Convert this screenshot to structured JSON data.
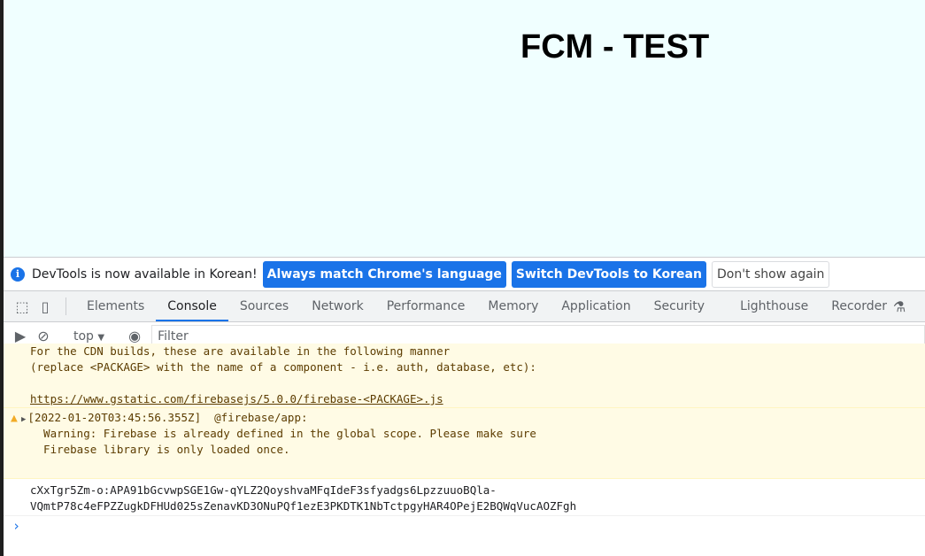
{
  "page": {
    "title": "FCM - TEST"
  },
  "infobar": {
    "message": "DevTools is now available in Korean!",
    "btn_match": "Always match Chrome's language",
    "btn_switch": "Switch DevTools to Korean",
    "btn_dismiss": "Don't show again"
  },
  "tabs": [
    "Elements",
    "Console",
    "Sources",
    "Network",
    "Performance",
    "Memory",
    "Application",
    "Security",
    "Lighthouse",
    "Recorder"
  ],
  "active_tab": "Console",
  "toolbar": {
    "context": "top",
    "filter_placeholder": "Filter"
  },
  "console": {
    "warning1": {
      "lines": [
        "For the CDN builds, these are available in the following manner",
        "(replace <PACKAGE> with the name of a component - i.e. auth, database, etc):",
        ""
      ],
      "link": "https://www.gstatic.com/firebasejs/5.0.0/firebase-<PACKAGE>.js"
    },
    "warning2": {
      "header": "[2022-01-20T03:45:56.355Z]  @firebase/app:",
      "lines": [
        "  Warning: Firebase is already defined in the global scope. Please make sure",
        "  Firebase library is only loaded once."
      ]
    },
    "log": [
      "cXxTgr5Zm-o:APA91bGcvwpSGE1Gw-qYLZ2QoyshvaMFqIdeF3sfyadgs6LpzzuuoBQla-",
      "VQmtP78c4eFPZZugkDFHUd025sZenavKD3ONuPQf1ezE3PKDTK1NbTctpgyHAR4OPejE2BQWqVucAOZFgh"
    ],
    "prompt": "›"
  },
  "colors": {
    "accent": "#1a73e8",
    "warning_bg": "#fffbe5",
    "page_bg": "#f0ffff"
  }
}
